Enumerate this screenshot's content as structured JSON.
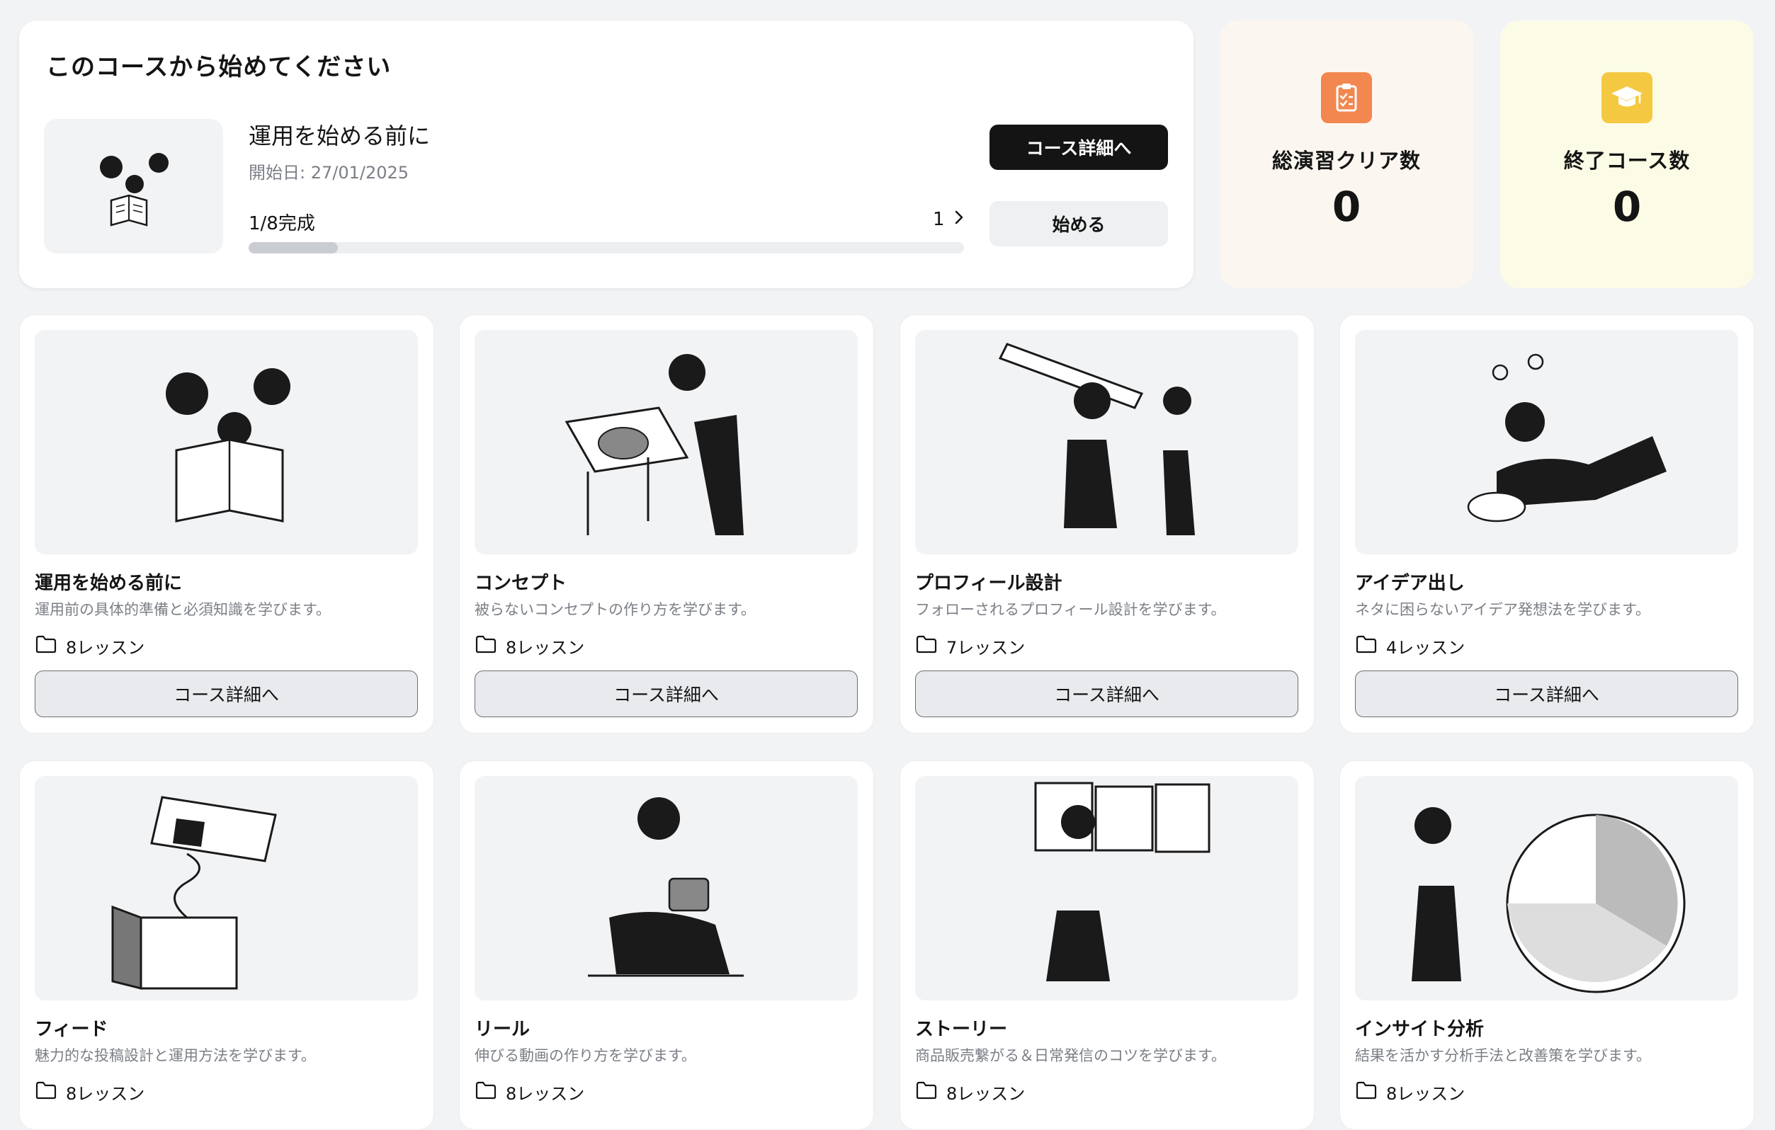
{
  "featured": {
    "heading": "このコースから始めてください",
    "course_name": "運用を始める前に",
    "start_date": "開始日: 27/01/2025",
    "progress_text": "1/8完成",
    "progress_count": "1",
    "progress_fraction": 0.125,
    "detail_label": "コース詳細へ",
    "start_label": "始める"
  },
  "stats": {
    "exercises_label": "総演習クリア数",
    "exercises_value": "0",
    "courses_label": "終了コース数",
    "courses_value": "0",
    "exercises_icon": "clipboard-check-icon",
    "courses_icon": "graduation-cap-icon",
    "exercises_color": "#f2874f",
    "courses_color": "#f5c842"
  },
  "courses": [
    {
      "name": "運用を始める前に",
      "desc": "運用前の具体的準備と必須知識を学びます。",
      "lessons": "8レッスン",
      "detail": "コース詳細へ"
    },
    {
      "name": "コンセプト",
      "desc": "被らないコンセプトの作り方を学びます。",
      "lessons": "8レッスン",
      "detail": "コース詳細へ"
    },
    {
      "name": "プロフィール設計",
      "desc": "フォローされるプロフィール設計を学びます。",
      "lessons": "7レッスン",
      "detail": "コース詳細へ"
    },
    {
      "name": "アイデア出し",
      "desc": "ネタに困らないアイデア発想法を学びます。",
      "lessons": "4レッスン",
      "detail": "コース詳細へ"
    },
    {
      "name": "フィード",
      "desc": "魅力的な投稿設計と運用方法を学びます。",
      "lessons": "8レッスン"
    },
    {
      "name": "リール",
      "desc": "伸びる動画の作り方を学びます。",
      "lessons": "8レッスン"
    },
    {
      "name": "ストーリー",
      "desc": "商品販売繋がる＆日常発信のコツを学びます。",
      "lessons": "8レッスン"
    },
    {
      "name": "インサイト分析",
      "desc": "結果を活かす分析手法と改善策を学びます。",
      "lessons": "8レッスン"
    }
  ]
}
